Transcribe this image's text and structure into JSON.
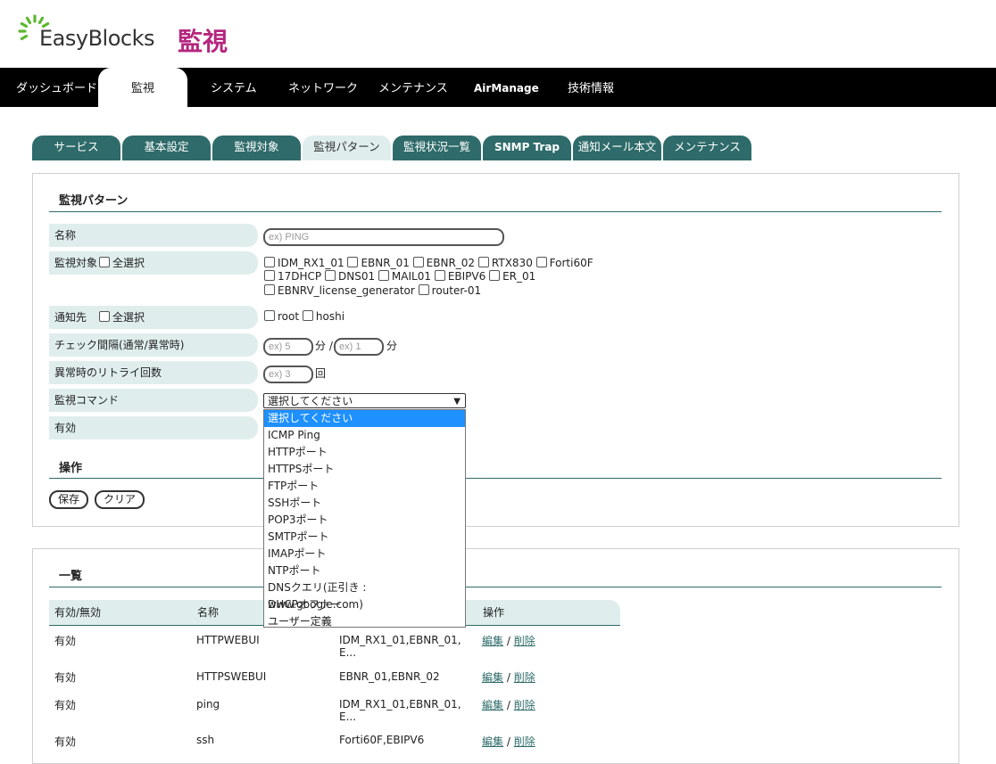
{
  "header": {
    "logo_text": "EasyBlocks",
    "logo_subtitle": "監視"
  },
  "topnav": [
    "ダッシュボード",
    "監視",
    "システム",
    "ネットワーク",
    "メンテナンス",
    "AirManage",
    "技術情報"
  ],
  "subtabs": [
    "サービス",
    "基本設定",
    "監視対象",
    "監視パターン",
    "監視状況一覧",
    "SNMP Trap",
    "通知メール本文",
    "メンテナンス"
  ],
  "form": {
    "section_title": "監視パターン",
    "name_label": "名称",
    "name_placeholder": "ex) PING",
    "targets_label": "監視対象",
    "select_all_label": "全選択",
    "targets": [
      "IDM_RX1_01",
      "EBNR_01",
      "EBNR_02",
      "RTX830",
      "Forti60F",
      "17DHCP",
      "DNS01",
      "MAIL01",
      "EBIPV6",
      "ER_01",
      "EBNRV_license_generator",
      "router-01"
    ],
    "notify_label": "通知先",
    "notify_targets": [
      "root",
      "hoshi"
    ],
    "interval_label": "チェック間隔(通常/異常時)",
    "interval_normal_placeholder": "ex) 5",
    "interval_unit": "分",
    "interval_separator": "/",
    "interval_error_placeholder": "ex) 1",
    "retry_label": "異常時のリトライ回数",
    "retry_placeholder": "ex) 3",
    "retry_unit": "回",
    "command_label": "監視コマンド",
    "command_selected": "選択してください",
    "command_options": [
      "選択してください",
      "ICMP Ping",
      "HTTPポート",
      "HTTPSポート",
      "FTPポート",
      "SSHポート",
      "POP3ポート",
      "SMTPポート",
      "IMAPポート",
      "NTPポート",
      "DNSクエリ(正引き : www.google.com)",
      "DHCPオファー",
      "ユーザー定義"
    ],
    "enabled_label": "有効",
    "ops_title": "操作",
    "save_label": "保存",
    "clear_label": "クリア"
  },
  "list": {
    "section_title": "一覧",
    "headers": [
      "有効/無効",
      "名称",
      "",
      "操作"
    ],
    "edit_label": "編集",
    "delete_label": "削除",
    "action_separator": "/",
    "rows": [
      {
        "enabled": "有効",
        "name": "HTTPWEBUI",
        "targets_line1": "IDM_RX1_01,EBNR_01,",
        "targets_line2": "E..."
      },
      {
        "enabled": "有効",
        "name": "HTTPSWEBUI",
        "targets_line1": "EBNR_01,EBNR_02",
        "targets_line2": ""
      },
      {
        "enabled": "有効",
        "name": "ping",
        "targets_line1": "IDM_RX1_01,EBNR_01,",
        "targets_line2": "E..."
      },
      {
        "enabled": "有効",
        "name": "ssh",
        "targets_line1": "Forti60F,EBIPV6",
        "targets_line2": ""
      }
    ]
  },
  "colors": {
    "accent": "#2e6b6a",
    "label_bg": "#dfeeed",
    "brand": "#b5267e",
    "nav_bg": "#000000",
    "highlight": "#1e90ff"
  }
}
